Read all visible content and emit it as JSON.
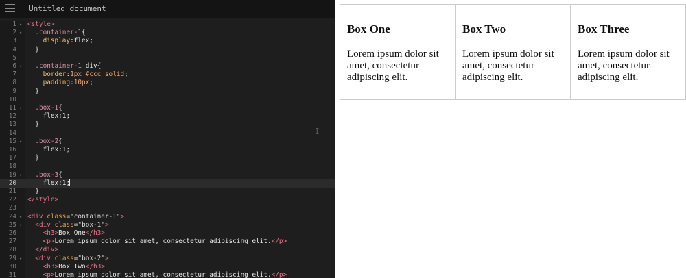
{
  "editor": {
    "document_title": "Untitled document",
    "lines": [
      {
        "n": "1",
        "html": "<span class='t'>&lt;style&gt;</span>"
      },
      {
        "n": "2",
        "html": "  <span class='sel'>.container-1</span><span class='x'>{</span>"
      },
      {
        "n": "3",
        "html": "    <span class='prop'>display</span><span class='x'>:</span><span class='x'>flex;</span>"
      },
      {
        "n": "4",
        "html": "  <span class='x'>}</span>"
      },
      {
        "n": "5",
        "html": ""
      },
      {
        "n": "6",
        "html": "  <span class='sel'>.container-1</span> <span class='x'>div{</span>"
      },
      {
        "n": "7",
        "html": "    <span class='prop'>border</span><span class='x'>:</span><span class='val'>1px #ccc solid</span><span class='x'>;</span>"
      },
      {
        "n": "8",
        "html": "    <span class='prop'>padding</span><span class='x'>:</span><span class='val'>10px</span><span class='x'>;</span>"
      },
      {
        "n": "9",
        "html": "  <span class='x'>}</span>"
      },
      {
        "n": "10",
        "html": ""
      },
      {
        "n": "11",
        "html": "  <span class='sel'>.box-1</span><span class='x'>{</span>"
      },
      {
        "n": "12",
        "html": "    <span class='x'>flex:1;</span>"
      },
      {
        "n": "13",
        "html": "  <span class='x'>}</span>"
      },
      {
        "n": "14",
        "html": ""
      },
      {
        "n": "15",
        "html": "  <span class='sel'>.box-2</span><span class='x'>{</span>"
      },
      {
        "n": "16",
        "html": "    <span class='x'>flex:1;</span>"
      },
      {
        "n": "17",
        "html": "  <span class='x'>}</span>"
      },
      {
        "n": "18",
        "html": ""
      },
      {
        "n": "19",
        "html": "  <span class='sel'>.box-3</span><span class='x'>{</span>"
      },
      {
        "n": "20",
        "html": "    <span class='x'>flex:1;</span>"
      },
      {
        "n": "21",
        "html": "  <span class='x'>}</span>"
      },
      {
        "n": "22",
        "html": "<span class='t'>&lt;/style&gt;</span>"
      },
      {
        "n": "23",
        "html": ""
      },
      {
        "n": "24",
        "html": "<span class='t'>&lt;div</span> <span class='a'>class</span><span class='x'>=</span><span class='s'>\"container-1\"</span><span class='t'>&gt;</span>"
      },
      {
        "n": "25",
        "html": "  <span class='t'>&lt;div</span> <span class='a'>class</span><span class='x'>=</span><span class='s'>\"box-1\"</span><span class='t'>&gt;</span>"
      },
      {
        "n": "26",
        "html": "    <span class='t'>&lt;h3&gt;</span><span class='x'>Box One</span><span class='t'>&lt;/h3&gt;</span>"
      },
      {
        "n": "27",
        "html": "    <span class='t'>&lt;p&gt;</span><span class='x'>Lorem ipsum dolor sit amet, consectetur adipiscing elit.</span><span class='t'>&lt;/p&gt;</span>"
      },
      {
        "n": "28",
        "html": "  <span class='t'>&lt;/div&gt;</span>"
      },
      {
        "n": "29",
        "html": "  <span class='t'>&lt;div</span> <span class='a'>class</span><span class='x'>=</span><span class='s'>\"box-2\"</span><span class='t'>&gt;</span>"
      },
      {
        "n": "30",
        "html": "    <span class='t'>&lt;h3&gt;</span><span class='x'>Box Two</span><span class='t'>&lt;/h3&gt;</span>"
      },
      {
        "n": "31",
        "html": "    <span class='t'>&lt;p&gt;</span><span class='x'>Lorem ipsum dolor sit amet, consectetur adipiscing elit.</span><span class='t'>&lt;/p&gt;</span>"
      }
    ],
    "fold_lines": [
      "1",
      "2",
      "6",
      "11",
      "15",
      "19",
      "24",
      "25",
      "29"
    ],
    "active_line": "20",
    "menu_icon": "hamburger-menu-icon"
  },
  "preview": {
    "boxes": [
      {
        "heading": "Box One",
        "text": "Lorem ipsum dolor sit amet, consectetur adipiscing elit."
      },
      {
        "heading": "Box Two",
        "text": "Lorem ipsum dolor sit amet, consectetur adipiscing elit."
      },
      {
        "heading": "Box Three",
        "text": "Lorem ipsum dolor sit amet, consectetur adipiscing elit."
      }
    ],
    "border_color": "#cccccc"
  },
  "colors": {
    "editor_bg": "#1e1e1e",
    "tag": "#e8728a",
    "attribute": "#e0a14e",
    "property": "#f2c26b",
    "value": "#f3a46a"
  }
}
